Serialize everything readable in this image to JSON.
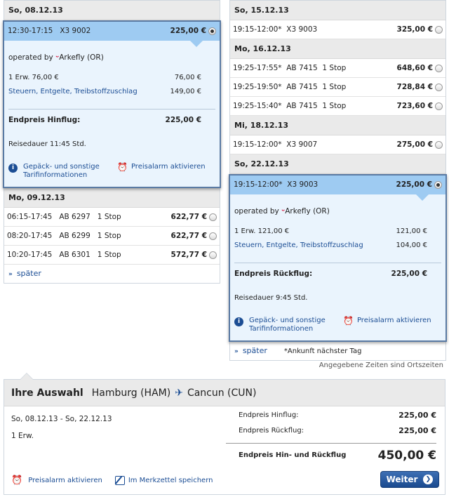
{
  "outbound": {
    "day1": {
      "header": "So, 08.12.13",
      "selected": {
        "time": "12:30-17:15",
        "flight": "X3 9002",
        "price": "225,00 €",
        "operated_prefix": "operated by",
        "airline": "Arkefly (OR)",
        "pax_line": "1 Erw. 76,00 €",
        "pax_amount": "76,00 €",
        "tax_line": "Steuern, Entgelte, Treibstoffzuschlag",
        "tax_amount": "149,00 €",
        "total_label": "Endpreis Hinflug:",
        "total_amount": "225,00 €",
        "duration": "Reisedauer 11:45 Std.",
        "info_link": "Gepäck- und sonstige Tarifinformationen",
        "alarm_link": "Preisalarm aktivieren"
      }
    },
    "day2": {
      "header": "Mo, 09.12.13",
      "rows": [
        {
          "time": "06:15-17:45",
          "flight": "AB 6297",
          "stops": "1 Stop",
          "price": "622,77 €"
        },
        {
          "time": "08:20-17:45",
          "flight": "AB 6299",
          "stops": "1 Stop",
          "price": "622,77 €"
        },
        {
          "time": "10:20-17:45",
          "flight": "AB 6301",
          "stops": "1 Stop",
          "price": "572,77 €"
        }
      ]
    },
    "later": "später"
  },
  "return": {
    "day1": {
      "header": "So, 15.12.13",
      "rows": [
        {
          "time": "19:15-12:00*",
          "flight": "X3 9003",
          "stops": "",
          "price": "325,00 €"
        }
      ]
    },
    "day2": {
      "header": "Mo, 16.12.13",
      "rows": [
        {
          "time": "19:25-17:55*",
          "flight": "AB 7415",
          "stops": "1 Stop",
          "price": "648,60 €"
        },
        {
          "time": "19:25-19:50*",
          "flight": "AB 7415",
          "stops": "1 Stop",
          "price": "728,84 €"
        },
        {
          "time": "19:25-15:40*",
          "flight": "AB 7415",
          "stops": "1 Stop",
          "price": "723,60 €"
        }
      ]
    },
    "day3": {
      "header": "Mi, 18.12.13",
      "rows": [
        {
          "time": "19:15-12:00*",
          "flight": "X3 9007",
          "stops": "",
          "price": "275,00 €"
        }
      ]
    },
    "day4": {
      "header": "So, 22.12.13",
      "selected": {
        "time": "19:15-12:00*",
        "flight": "X3 9003",
        "price": "225,00 €",
        "operated_prefix": "operated by",
        "airline": "Arkefly (OR)",
        "pax_line": "1 Erw. 121,00 €",
        "pax_amount": "121,00 €",
        "tax_line": "Steuern, Entgelte, Treibstoffzuschlag",
        "tax_amount": "104,00 €",
        "total_label": "Endpreis Rückflug:",
        "total_amount": "225,00 €",
        "duration": "Reisedauer 9:45 Std.",
        "info_link": "Gepäck- und sonstige Tarifinformationen",
        "alarm_link": "Preisalarm aktivieren"
      }
    },
    "later": "später",
    "footnote": "*Ankunft nächster Tag"
  },
  "note": "Angegebene Zeiten sind Ortszeiten",
  "summary": {
    "title": "Ihre Auswahl",
    "from": "Hamburg (HAM)",
    "to": "Cancun (CUN)",
    "dates": "So, 08.12.13 - So, 22.12.13",
    "pax": "1 Erw.",
    "out_label": "Endpreis Hinflug:",
    "out_amount": "225,00 €",
    "ret_label": "Endpreis Rückflug:",
    "ret_amount": "225,00 €",
    "grand_label": "Endpreis Hin- und Rückflug",
    "grand_amount": "450,00 €",
    "alarm": "Preisalarm aktivieren",
    "save": "Im Merkzettel speichern",
    "next": "Weiter"
  },
  "colors": {
    "selected_bar": "#9ecbf2",
    "selected_body": "#eaf4fd",
    "link": "#1b4d94",
    "button": "#1a4a8f"
  }
}
